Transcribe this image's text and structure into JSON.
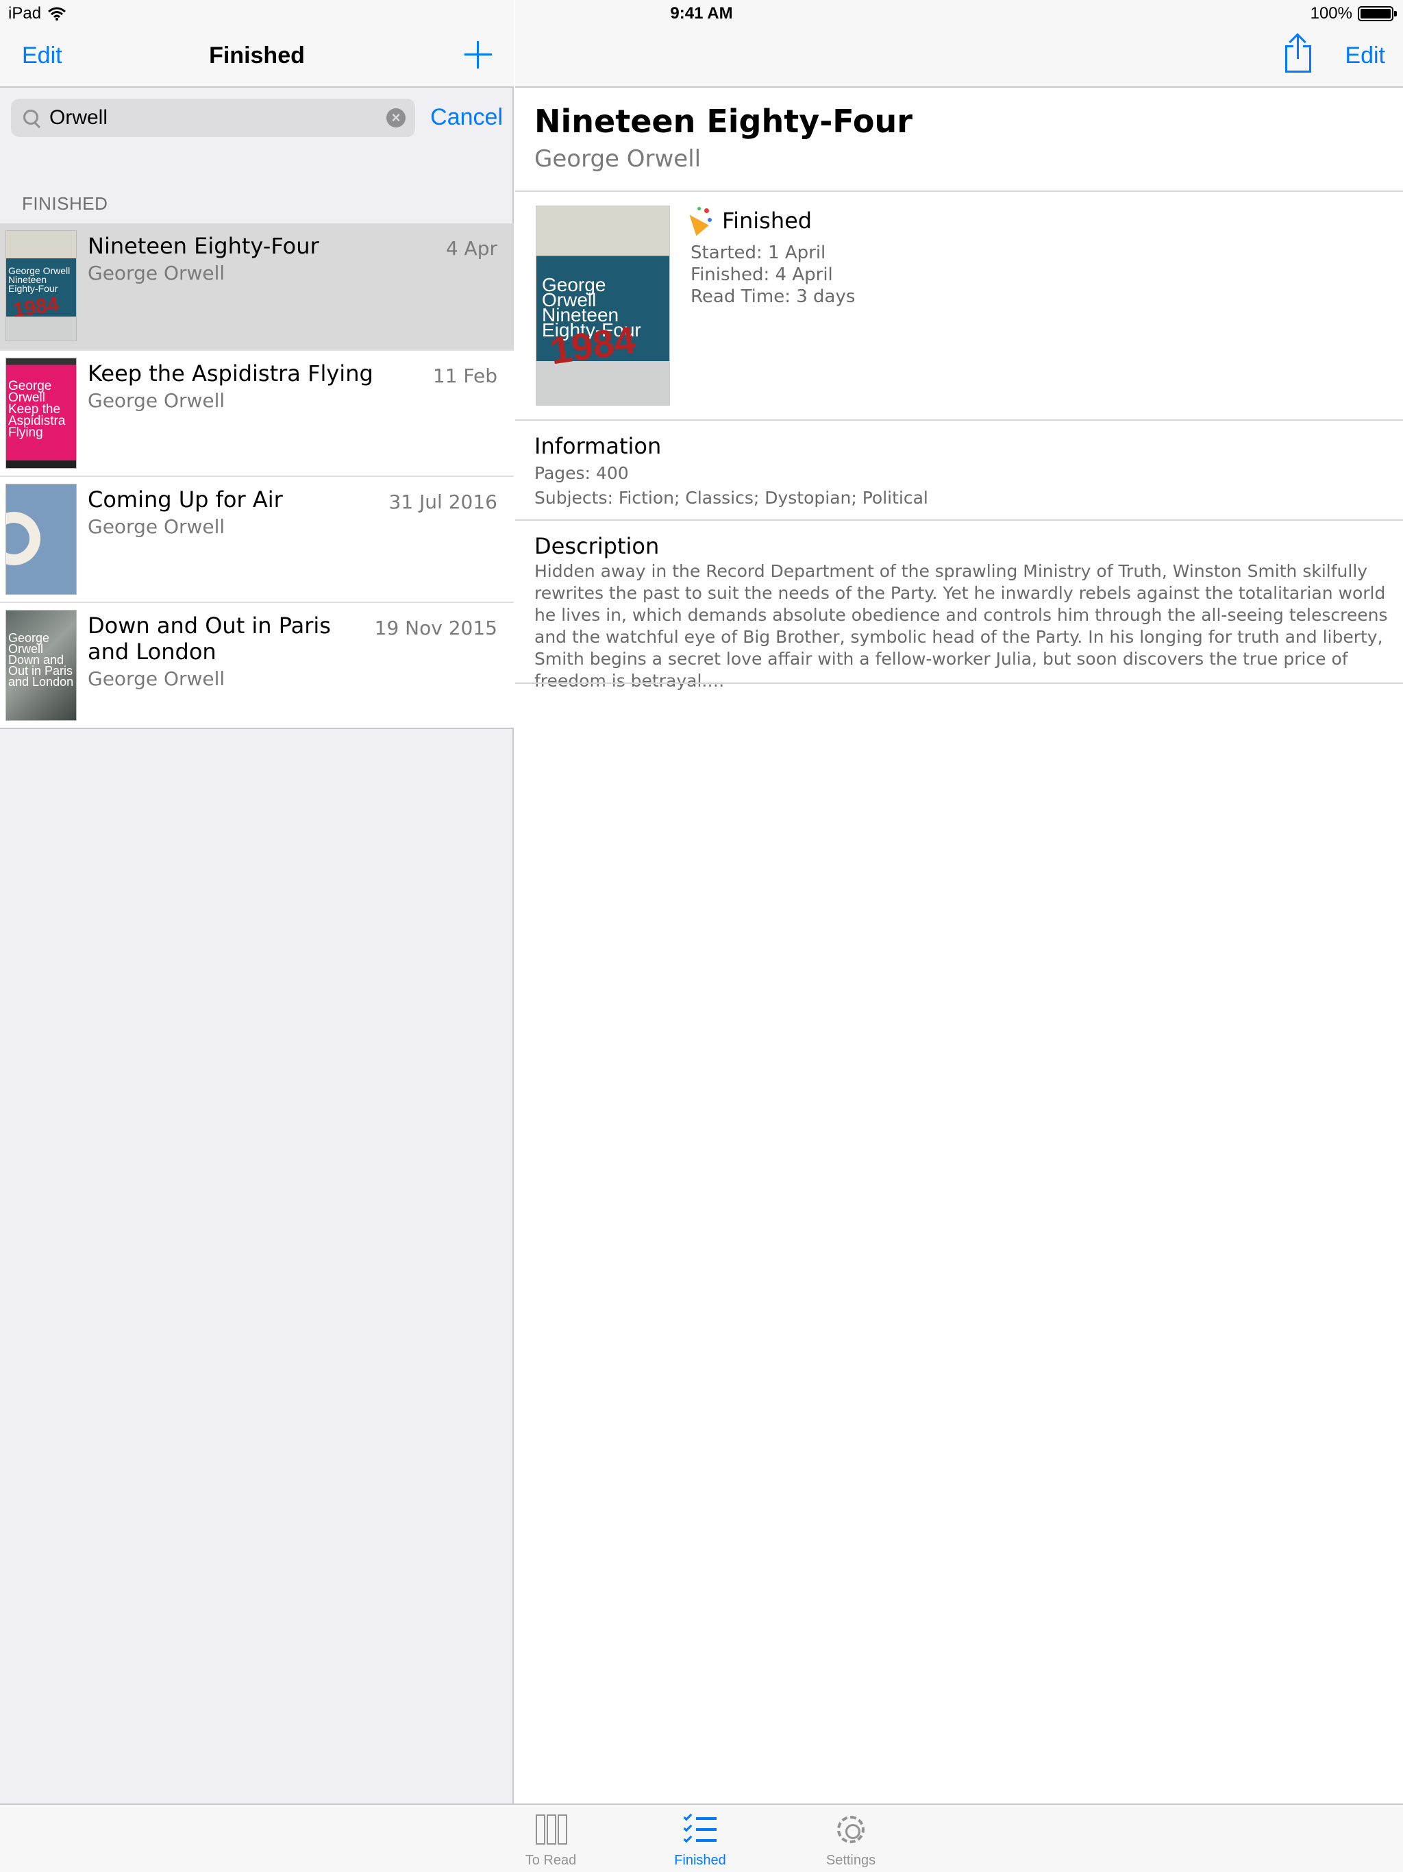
{
  "status_bar": {
    "device": "iPad",
    "time": "9:41 AM",
    "battery": "100%",
    "battery_level": 1.0
  },
  "master": {
    "nav": {
      "edit_label": "Edit",
      "title": "Finished"
    },
    "search": {
      "value": "Orwell",
      "cancel_label": "Cancel"
    },
    "section_header": "FINISHED",
    "books": [
      {
        "title": "Nineteen Eighty-Four",
        "author": "George Orwell",
        "date": "4 Apr",
        "cover_text": "George Orwell Nineteen Eighty-Four"
      },
      {
        "title": "Keep the Aspidistra Flying",
        "author": "George Orwell",
        "date": "11 Feb",
        "cover_text": "George Orwell Keep the Aspidistra Flying"
      },
      {
        "title": "Coming Up for Air",
        "author": "George Orwell",
        "date": "31 Jul 2016"
      },
      {
        "title": "Down and Out in Paris and London",
        "author": "George Orwell",
        "date": "19 Nov 2015",
        "cover_text": "George Orwell Down and Out in Paris and London"
      }
    ]
  },
  "detail": {
    "nav": {
      "edit_label": "Edit"
    },
    "title": "Nineteen Eighty-Four",
    "author": "George Orwell",
    "cover_text": "George Orwell Nineteen Eighty-Four",
    "status": "Finished",
    "started": "Started: 1 April",
    "finished": "Finished: 4 April",
    "read_time": "Read Time: 3 days",
    "information": {
      "heading": "Information",
      "pages": "Pages: 400",
      "subjects": "Subjects: Fiction; Classics; Dystopian; Political"
    },
    "description": {
      "heading": "Description",
      "text": "Hidden away in the Record Department of the sprawling Ministry of Truth, Winston Smith skilfully rewrites the past to suit the needs of the Party. Yet he inwardly rebels against the totalitarian world he lives in, which demands absolute obedience and controls him through the all-seeing telescreens and the watchful eye of Big Brother, symbolic head of the Party. In his longing for truth and liberty, Smith begins a secret love affair with a fellow-worker Julia, but soon discovers the true price of freedom is betrayal.…"
    }
  },
  "tabbar": {
    "tabs": [
      {
        "label": "To Read",
        "icon": "books-icon"
      },
      {
        "label": "Finished",
        "icon": "checklist-icon",
        "active": true
      },
      {
        "label": "Settings",
        "icon": "gear-icon"
      }
    ]
  },
  "colors": {
    "accent": "#007aff",
    "selected_row": "#d9d9d9",
    "background": "#efeff4"
  }
}
